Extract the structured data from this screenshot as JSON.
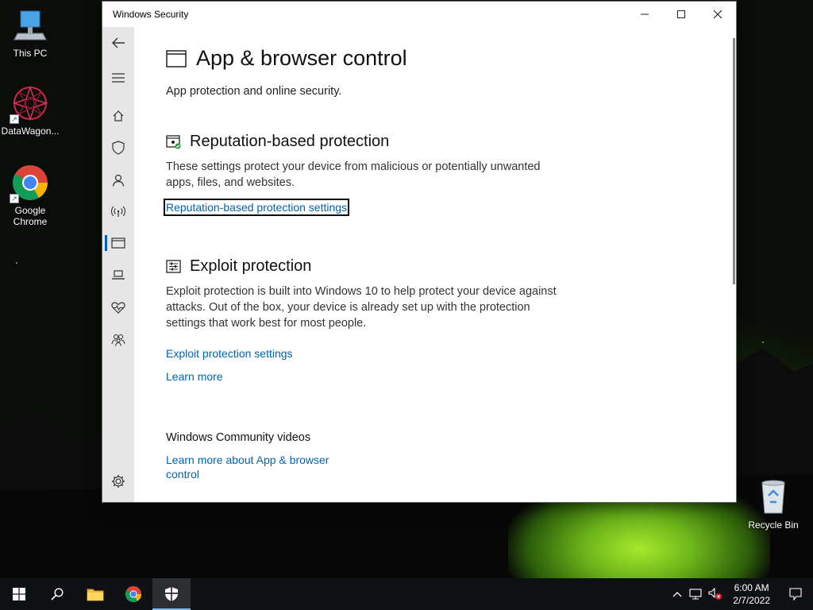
{
  "desktop": {
    "icons": [
      {
        "label": "This PC"
      },
      {
        "label": "DataWagon..."
      },
      {
        "label": "Google\nChrome",
        "line1": "Google",
        "line2": "Chrome"
      },
      {
        "label": "Recycle Bin"
      }
    ]
  },
  "window": {
    "title": "Windows Security",
    "controls": {
      "minimize": "—",
      "maximize": "☐",
      "close": "✕"
    }
  },
  "sidebar": {
    "items": [
      {
        "icon": "back-arrow-icon"
      },
      {
        "icon": "hamburger-menu-icon"
      },
      {
        "icon": "home-icon"
      },
      {
        "icon": "shield-icon"
      },
      {
        "icon": "person-icon"
      },
      {
        "icon": "wifi-icon"
      },
      {
        "icon": "app-browser-icon",
        "active": true
      },
      {
        "icon": "laptop-icon"
      },
      {
        "icon": "heart-health-icon"
      },
      {
        "icon": "family-icon"
      },
      {
        "icon": "gear-icon"
      }
    ]
  },
  "page": {
    "title": "App & browser control",
    "subtitle": "App protection and online security.",
    "sections": {
      "reputation": {
        "heading": "Reputation-based protection",
        "description": "These settings protect your device from malicious or potentially unwanted apps, files, and websites.",
        "link": "Reputation-based protection settings"
      },
      "exploit": {
        "heading": "Exploit protection",
        "description": "Exploit protection is built into Windows 10 to help protect your device against attacks.  Out of the box, your device is already set up with the protection settings that work best for most people.",
        "link": "Exploit protection settings",
        "learn_more": "Learn more"
      },
      "community": {
        "heading": "Windows Community videos",
        "link_line1": "Learn more about App & browser",
        "link_line2": "control"
      }
    }
  },
  "taskbar": {
    "time": "6:00 AM",
    "date": "2/7/2022"
  },
  "colors": {
    "accent": "#0063b1",
    "sidebar_bg": "#e6e6e6",
    "taskbar_bg": "#101114"
  }
}
